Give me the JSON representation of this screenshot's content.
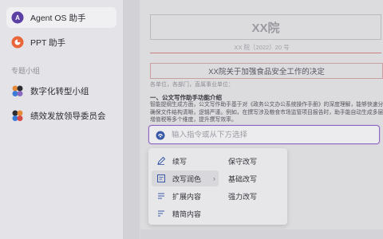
{
  "sidebar": {
    "items": [
      {
        "label": "Agent OS 助手",
        "icon": "agent-os-logo-icon"
      },
      {
        "label": "PPT 助手",
        "icon": "ppt-icon"
      }
    ],
    "section_label": "专题小组",
    "groups": [
      {
        "label": "数字化转型小组",
        "icon": "group-avatars-icon"
      },
      {
        "label": "绩效发放领导委员会",
        "icon": "group-avatars-icon"
      }
    ]
  },
  "document": {
    "title": "XX院",
    "number": "XX 院〔2022〕20 号",
    "heading": "XX院关于加强食品安全工作的决定",
    "recipients": "各单位，各部门，直属事业单位：",
    "section_heading": "一、公文写作助手功能介绍",
    "paragraph_lines": [
      "智能提纲生成方面，公文写作助手基于对《政务公文办公系统操作手册》的深度理解，能够快速分析文档要求",
      "确保文件结构清晰，逻辑严谨。例如，在撰写涉及粮食市场监管项目报告时，助手能自动生成多层级提纲，涵盖",
      "增值税等多个维度，提升撰写效率。"
    ]
  },
  "command": {
    "placeholder": "输入指令或从下方选择"
  },
  "menu": {
    "left": [
      {
        "label": "续写",
        "icon": "pen-icon"
      },
      {
        "label": "改写润色",
        "icon": "rewrite-icon",
        "has_submenu": true
      },
      {
        "label": "扩展内容",
        "icon": "expand-icon"
      },
      {
        "label": "精简内容",
        "icon": "condense-icon"
      }
    ],
    "right": [
      {
        "label": "保守改写"
      },
      {
        "label": "基础改写"
      },
      {
        "label": "强力改写"
      }
    ],
    "submenu_arrow": "›"
  },
  "colors": {
    "accent": "#8a6ac0",
    "agent_logo": "#5b3fa3",
    "ppt_logo": "#e8663a",
    "doc_red": "#c98080"
  }
}
